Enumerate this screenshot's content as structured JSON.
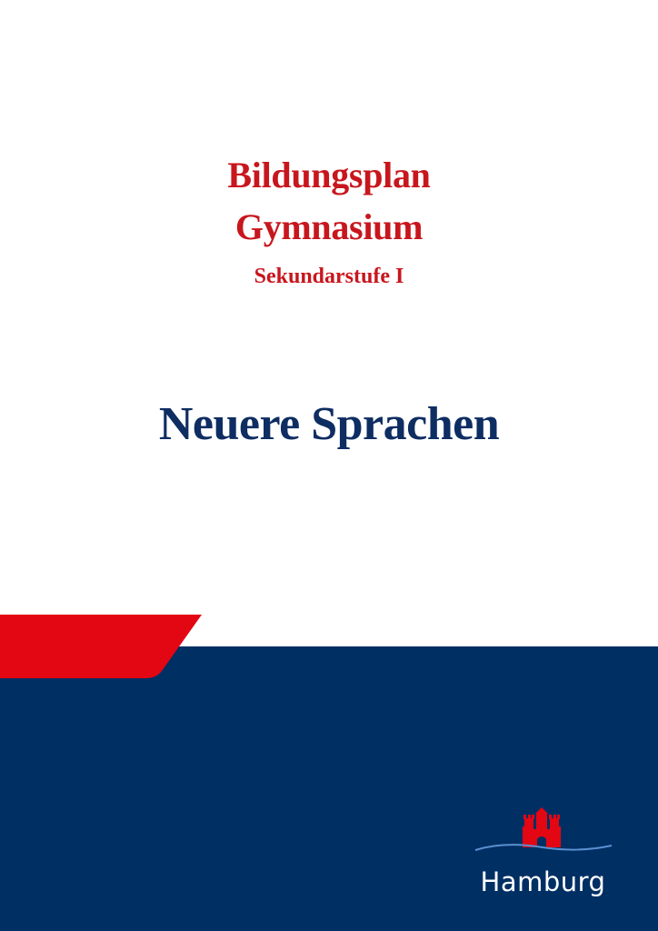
{
  "document": {
    "title_line1": "Bildungsplan",
    "title_line2": "Gymnasium",
    "subtitle": "Sekundarstufe I",
    "subject": "Neuere Sprachen"
  },
  "branding": {
    "city_name": "Hamburg",
    "logo_icon": "hamburg-castle-icon"
  },
  "colors": {
    "title_red": "#c8161d",
    "subject_navy": "#0e2d62",
    "band_navy": "#002f63",
    "tab_red": "#e30613",
    "logo_red": "#e30613",
    "logo_wave": "#5a8fd0",
    "logo_text": "#ffffff"
  }
}
